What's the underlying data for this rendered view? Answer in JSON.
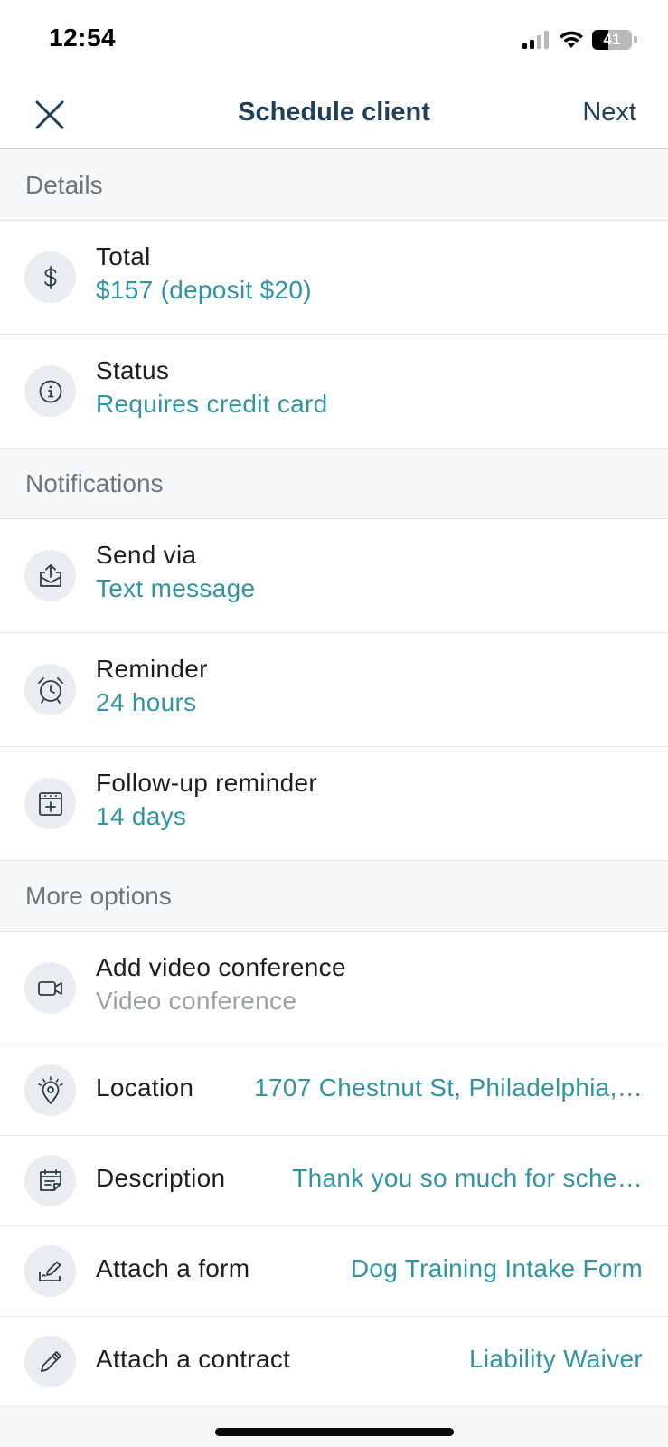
{
  "status_bar": {
    "time": "12:54",
    "battery": "41",
    "battery_level": 0.41
  },
  "nav": {
    "title": "Schedule client",
    "next_label": "Next"
  },
  "sections": {
    "details": {
      "header": "Details",
      "total": {
        "label": "Total",
        "value": "$157 (deposit $20)",
        "icon": "dollar-icon"
      },
      "status": {
        "label": "Status",
        "value": "Requires credit card",
        "icon": "info-icon"
      }
    },
    "notifications": {
      "header": "Notifications",
      "send_via": {
        "label": "Send via",
        "value": "Text message",
        "icon": "outbox-icon"
      },
      "reminder": {
        "label": "Reminder",
        "value": "24 hours",
        "icon": "alarm-clock-icon"
      },
      "follow_up": {
        "label": "Follow-up reminder",
        "value": "14 days",
        "icon": "calendar-add-icon"
      }
    },
    "more_options": {
      "header": "More options",
      "video": {
        "label": "Add video conference",
        "value": "Video conference",
        "icon": "video-camera-icon"
      },
      "location": {
        "label": "Location",
        "value": "1707 Chestnut St, Philadelphia,…",
        "icon": "location-pin-icon"
      },
      "description": {
        "label": "Description",
        "value": "Thank you so much for sche…",
        "icon": "note-icon"
      },
      "form": {
        "label": "Attach a form",
        "value": "Dog Training Intake Form",
        "icon": "form-edit-icon"
      },
      "contract": {
        "label": "Attach a contract",
        "value": "Liability Waiver",
        "icon": "pen-icon"
      }
    }
  },
  "colors": {
    "accent": "#2e95a3",
    "nav_text": "#1f3f5c",
    "muted": "#9aa1a7",
    "section_bg": "#f6f7f8"
  }
}
